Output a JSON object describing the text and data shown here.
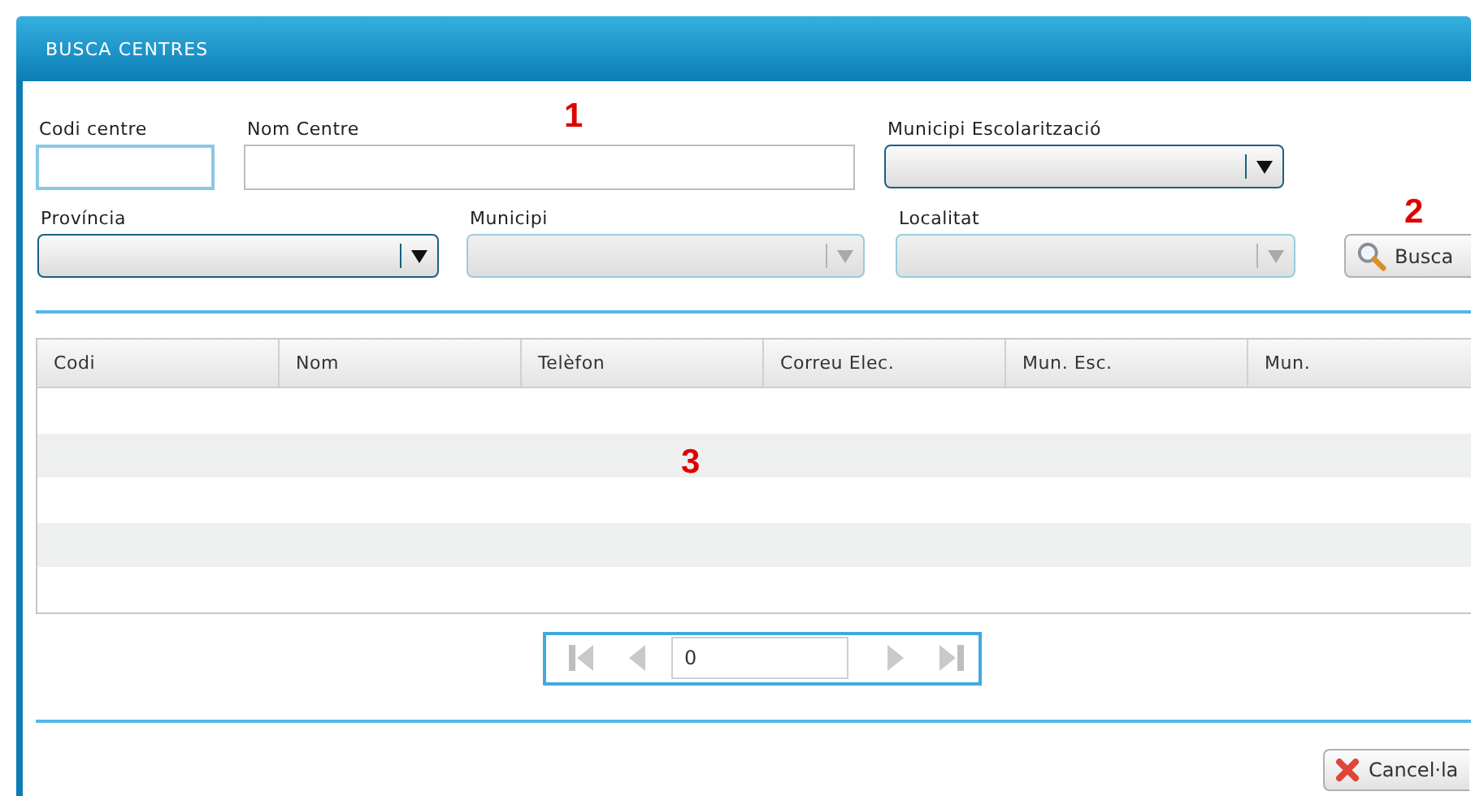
{
  "window": {
    "title": "BUSCA CENTRES"
  },
  "filter_rows": [
    [
      {
        "kind": "text",
        "label": "Codi centre",
        "focused": true
      },
      {
        "kind": "text",
        "label": "Nom Centre",
        "focused": false
      },
      {
        "kind": "select",
        "label": "Municipi Escolarització",
        "disabled": false
      }
    ],
    [
      {
        "kind": "select",
        "label": "Província",
        "disabled": false
      },
      {
        "kind": "select",
        "label": "Municipi",
        "disabled": true
      },
      {
        "kind": "select",
        "label": "Localitat",
        "disabled": true
      },
      {
        "kind": "button",
        "label": "Busca"
      }
    ]
  ],
  "table": {
    "columns": [
      "Codi",
      "Nom",
      "Telèfon",
      "Correu Elec.",
      "Mun. Esc.",
      "Mun."
    ]
  },
  "pager": {
    "before": [
      {
        "kind": "first",
        "disabled": true
      },
      {
        "kind": "prev",
        "disabled": true
      }
    ],
    "page": "0",
    "after": [
      {
        "kind": "next",
        "disabled": true
      },
      {
        "kind": "last",
        "disabled": true
      }
    ]
  },
  "cancel_button": {
    "label": "Cancel·la"
  },
  "annotations": [
    "1",
    "2",
    "3"
  ]
}
